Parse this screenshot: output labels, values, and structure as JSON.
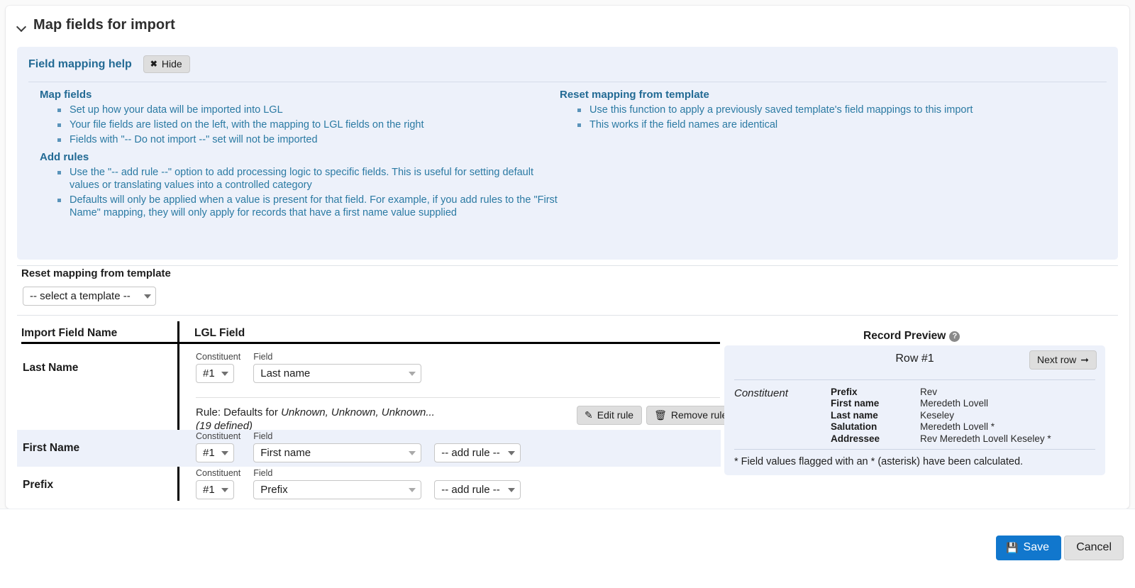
{
  "section": {
    "title": "Map fields for import",
    "chevron_icon": "chevron-down-icon"
  },
  "help_panel": {
    "title": "Field mapping help",
    "hide_button": {
      "label": "Hide",
      "icon": "close-x-icon"
    },
    "groups": [
      {
        "heading": "Map fields",
        "items": [
          "Set up how your data will be imported into LGL",
          "Your file fields are listed on the left, with the mapping to LGL fields on the right",
          "Fields with \"-- Do not import --\" set will not be imported"
        ]
      },
      {
        "heading": "Add rules",
        "items": [
          "Use the \"-- add rule --\" option to add processing logic to specific fields. This is useful for setting default values or translating values into a controlled category",
          "Defaults will only be applied when a value is present for that field. For example, if you add rules to the \"First Name\" mapping, they will only apply for records that have a first name value supplied"
        ]
      }
    ],
    "right_group": {
      "heading": "Reset mapping from template",
      "items": [
        "Use this function to apply a previously saved template's field mappings to this import",
        "This works if the field names are identical"
      ]
    }
  },
  "reset_mapping": {
    "label": "Reset mapping from template",
    "select_value": "-- select a template --"
  },
  "table": {
    "headers": {
      "import_field": "Import Field Name",
      "lgl_field": "LGL Field"
    },
    "labels": {
      "constituent": "Constituent",
      "field": "Field"
    },
    "rows": [
      {
        "import_field": "Last Name",
        "constituent": "#1",
        "lgl_field": "Last name",
        "rule": {
          "prefix": "Rule: Defaults for ",
          "italic": "Unknown, Unknown, Unknown...",
          "count": "(19 defined)",
          "edit_label": "Edit rule",
          "edit_icon": "pencil-icon",
          "remove_label": "Remove rule",
          "remove_icon": "trash-icon"
        }
      },
      {
        "import_field": "First Name",
        "constituent": "#1",
        "lgl_field": "First name",
        "add_rule": "-- add rule --"
      },
      {
        "import_field": "Prefix",
        "constituent": "#1",
        "lgl_field": "Prefix",
        "add_rule": "-- add rule --"
      }
    ]
  },
  "record_preview": {
    "title": "Record Preview",
    "help_icon": "question-mark-icon",
    "row_label": "Row #1",
    "next_row_label": "Next row",
    "next_row_icon": "arrow-right-icon",
    "entity": "Constituent",
    "fields": [
      {
        "name": "Prefix",
        "value": "Rev"
      },
      {
        "name": "First name",
        "value": "Meredeth Lovell"
      },
      {
        "name": "Last name",
        "value": "Keseley"
      },
      {
        "name": "Salutation",
        "value": "Meredeth Lovell *"
      },
      {
        "name": "Addressee",
        "value": "Rev Meredeth Lovell Keseley *"
      }
    ],
    "footnote": "* Field values flagged with an * (asterisk) have been calculated."
  },
  "footer": {
    "save_label": "Save",
    "save_icon": "floppy-disk-icon",
    "cancel_label": "Cancel"
  },
  "colors": {
    "panel_bg": "#edf1fa",
    "link_blue": "#2b7aa3",
    "heading_blue": "#226a94",
    "primary_button": "#1177cd"
  }
}
